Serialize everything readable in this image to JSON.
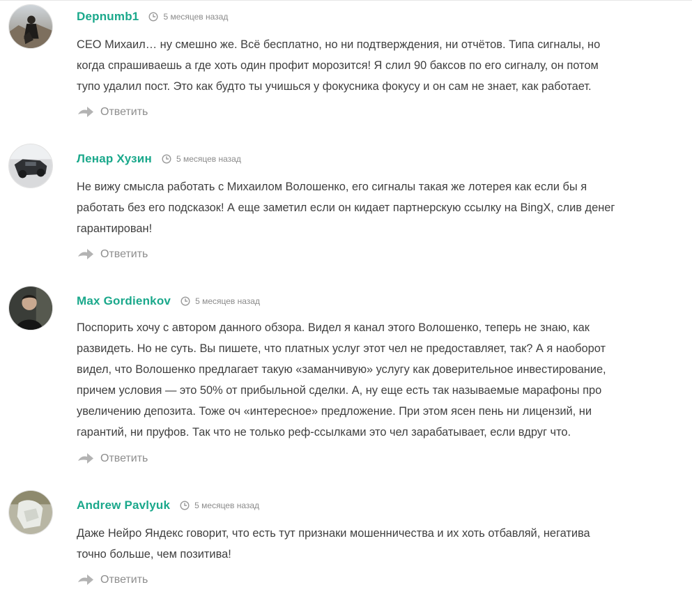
{
  "comments": [
    {
      "author": "Depnumb1",
      "time": "5 месяцев назад",
      "text": "CEO Михаил… ну смешно же. Всё бесплатно, но ни подтверждения, ни отчётов. Типа сигналы, но\nкогда спрашиваешь а где хоть один профит морозится! Я слил 90 баксов по его сигналу, он потом\nтупо удалил пост. Это как будто ты учишься у фокусника фокусу и он сам не знает, как работает.",
      "reply_label": "Ответить"
    },
    {
      "author": "Ленар Хузин",
      "time": "5 месяцев назад",
      "text": "Не вижу смысла работать с Михаилом Волошенко, его сигналы такая же лотерея как если бы я\nработать без его подсказок! А еще заметил если он кидает партнерскую ссылку на BingX, слив денег\nгарантирован!",
      "reply_label": "Ответить"
    },
    {
      "author": "Max Gordienkov",
      "time": "5 месяцев назад",
      "text": "Поспорить хочу с автором данного обзора. Видел я канал этого Волошенко, теперь не знаю, как\nразвидеть. Но не суть. Вы пишете, что платных услуг этот чел не предоставляет, так? А я наоборот\nвидел, что Волошенко предлагает такую «заманчивую» услугу как доверительное инвестирование,\nпричем условия — это 50% от прибыльной сделки. А, ну еще есть так называемые марафоны про\nувеличению депозита. Тоже оч «интересное» предложение. При этом ясен пень ни лицензий, ни\nгарантий, ни пруфов. Так что не только реф-ссылками это чел зарабатывает, если вдруг что.",
      "reply_label": "Ответить"
    },
    {
      "author": "Andrew Pavlyuk",
      "time": "5 месяцев назад",
      "text": "Даже Нейро Яндекс говорит, что есть тут признаки мошенничества и их хоть отбавляй, негатива\nточно больше, чем позитива!",
      "reply_label": "Ответить"
    }
  ],
  "colors": {
    "author": "#1aa88b",
    "text": "#3f3f3f",
    "muted": "#8b8b8b"
  },
  "icons": {
    "time": "clock-icon",
    "reply": "reply-arrow-icon"
  }
}
